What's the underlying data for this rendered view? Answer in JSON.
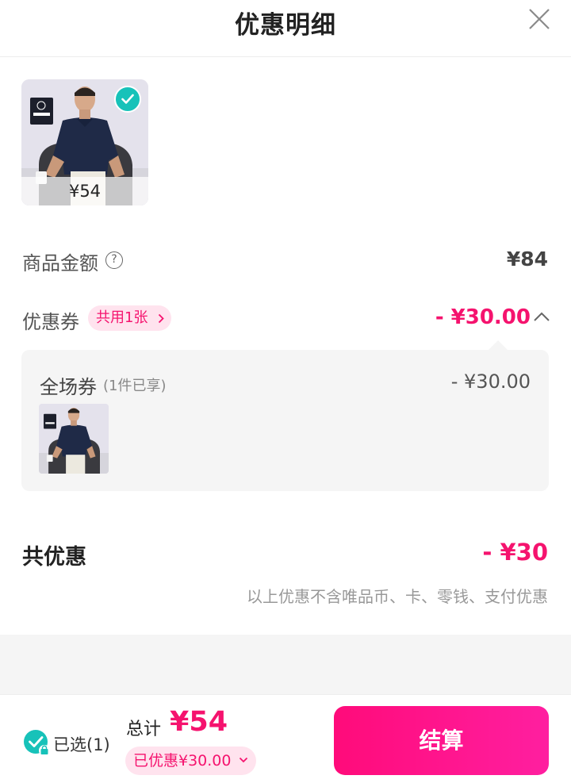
{
  "header": {
    "title": "优惠明细"
  },
  "product": {
    "price": "¥54",
    "selected": true
  },
  "amount_row": {
    "label": "商品金额",
    "help": "?",
    "value": "¥84"
  },
  "coupon_row": {
    "label": "优惠券",
    "tag": "共用1张",
    "value": "- ¥30.00"
  },
  "coupon_detail": {
    "name": "全场券",
    "sub": "(1件已享)",
    "value": "- ¥30.00"
  },
  "total_discount": {
    "label": "共优惠",
    "value": "- ¥30",
    "note": "以上优惠不含唯品币、卡、零钱、支付优惠"
  },
  "bottom_bar": {
    "selected_text": "已选(1)",
    "total_label": "总计",
    "total_value": "¥54",
    "saved_text": "已优惠¥30.00",
    "checkout_label": "结算"
  },
  "colors": {
    "accent": "#f5136e",
    "check": "#17c2b9",
    "tag_bg": "#ffe3ee"
  },
  "icons": [
    "close-icon",
    "check-icon",
    "help-icon",
    "chevron-right-icon",
    "chevron-up-icon",
    "chevron-down-icon",
    "lock-icon"
  ]
}
